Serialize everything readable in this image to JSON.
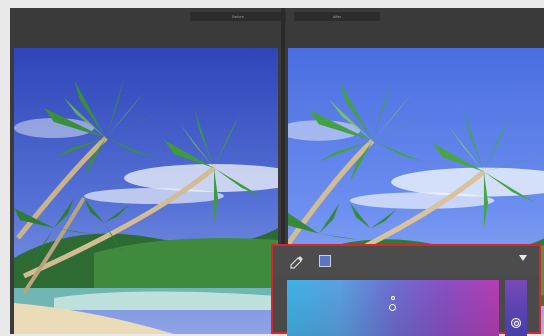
{
  "views": {
    "before_label": "Before",
    "after_label": "After"
  },
  "picker": {
    "swatch_color": "#5a74c8",
    "highlight_color": "#d9262a"
  },
  "icons": [
    "eyedropper-icon",
    "dropdown-arrow-icon"
  ]
}
